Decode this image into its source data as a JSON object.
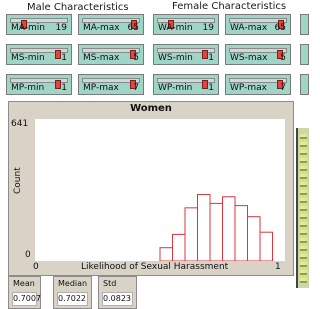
{
  "sections": {
    "male": "Male Characteristics",
    "female": "Female Characteristics"
  },
  "sliders": [
    {
      "label": "MA-min",
      "value": "19",
      "pos": 0.2
    },
    {
      "label": "MA-max",
      "value": "65",
      "pos": 0.92
    },
    {
      "label": "WA-min",
      "value": "19",
      "pos": 0.2
    },
    {
      "label": "WA-max",
      "value": "65",
      "pos": 0.92
    },
    {
      "label": "MS-min",
      "value": "1",
      "pos": 0.85
    },
    {
      "label": "MS-max",
      "value": "5",
      "pos": 0.9
    },
    {
      "label": "WS-min",
      "value": "1",
      "pos": 0.85
    },
    {
      "label": "WS-max",
      "value": "5",
      "pos": 0.9
    },
    {
      "label": "MP-min",
      "value": "1",
      "pos": 0.85
    },
    {
      "label": "MP-max",
      "value": "7",
      "pos": 0.9
    },
    {
      "label": "WP-min",
      "value": "1",
      "pos": 0.85
    },
    {
      "label": "WP-max",
      "value": "7",
      "pos": 0.9
    }
  ],
  "plot": {
    "title": "Women",
    "y_max_label": "641",
    "y_min_label": "0",
    "x_min_label": "0",
    "x_max_label": "1",
    "xlabel": "Likelihood of Sexual Harassment",
    "ylabel": "Count",
    "color": "#d9363e"
  },
  "chart_data": {
    "type": "bar",
    "title": "Women",
    "xlabel": "Likelihood of Sexual Harassment",
    "ylabel": "Count",
    "xlim": [
      0,
      1
    ],
    "ylim": [
      0,
      641
    ],
    "bins": [
      {
        "x0": 0.5,
        "x1": 0.55,
        "count": 60
      },
      {
        "x0": 0.55,
        "x1": 0.6,
        "count": 120
      },
      {
        "x0": 0.6,
        "x1": 0.65,
        "count": 240
      },
      {
        "x0": 0.65,
        "x1": 0.7,
        "count": 300
      },
      {
        "x0": 0.7,
        "x1": 0.75,
        "count": 260
      },
      {
        "x0": 0.75,
        "x1": 0.8,
        "count": 290
      },
      {
        "x0": 0.8,
        "x1": 0.85,
        "count": 250
      },
      {
        "x0": 0.85,
        "x1": 0.9,
        "count": 200
      },
      {
        "x0": 0.9,
        "x1": 0.95,
        "count": 130
      }
    ]
  },
  "monitors": [
    {
      "label": "Mean",
      "value": "0.7007"
    },
    {
      "label": "Median",
      "value": "0.7022"
    },
    {
      "label": "Std",
      "value": "0.0823"
    }
  ]
}
